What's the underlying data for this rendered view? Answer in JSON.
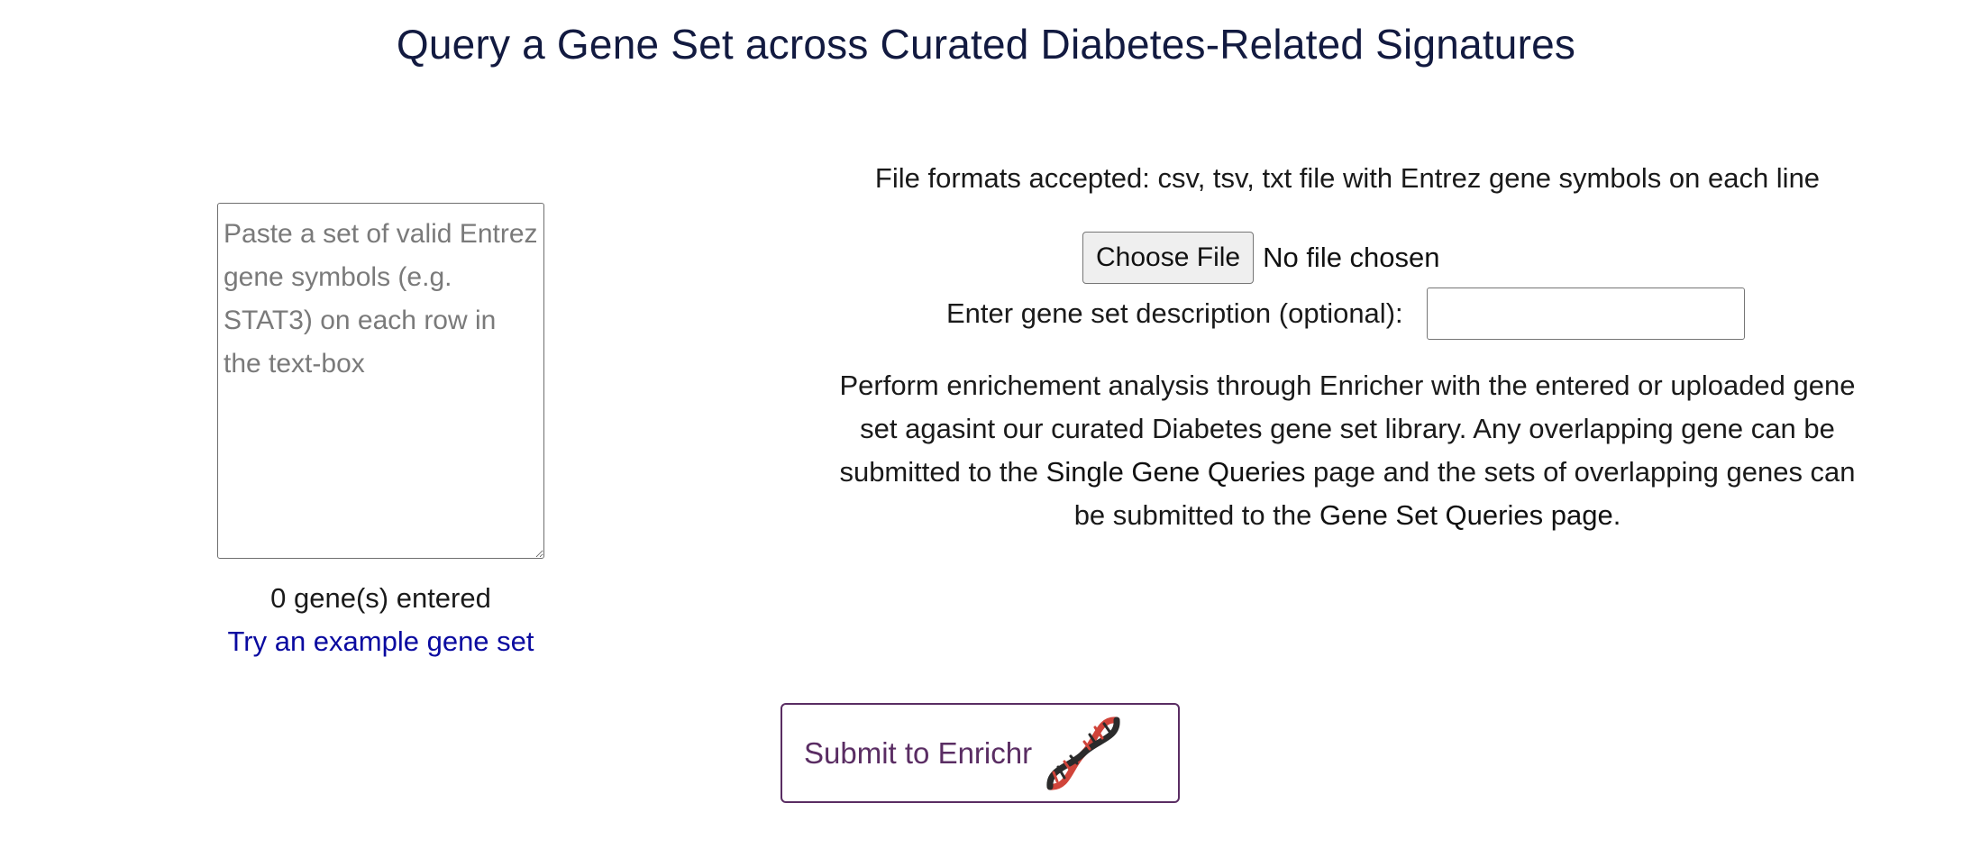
{
  "header": {
    "title": "Query a Gene Set across Curated Diabetes-Related Signatures"
  },
  "gene_input": {
    "placeholder": "Paste a set of valid Entrez gene symbols (e.g. STAT3) on each row in the text-box",
    "value": "",
    "count_text": "0 gene(s) entered",
    "example_link": "Try an example gene set"
  },
  "upload": {
    "formats_text": "File formats accepted: csv, tsv, txt file with Entrez gene symbols on each line",
    "choose_file_label": "Choose File",
    "no_file_text": "No file chosen",
    "description_label": "Enter gene set description (optional):",
    "description_value": ""
  },
  "info": {
    "part1": "Perform enrichement analysis through Enricher with the entered or uploaded gene set agasint our curated Diabetes gene set library. Any overlapping gene can be submitted to the ",
    "link1": "Single Gene Queries",
    "part2": " page and the sets of overlapping genes can be submitted to the ",
    "link2": "Gene Set Queries page",
    "part3": "."
  },
  "submit": {
    "label": "Submit to Enrichr",
    "icon": "dna-icon"
  },
  "colors": {
    "title": "#121a40",
    "link": "#0a0aa0",
    "submit_accent": "#5a2d63",
    "dna_red": "#d0443a",
    "dna_dark": "#2b2b2b"
  }
}
